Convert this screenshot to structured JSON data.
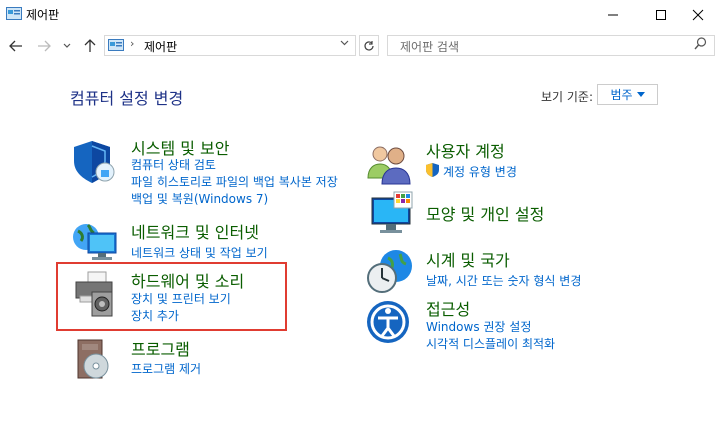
{
  "window": {
    "title": "제어판",
    "minimize_icon": "minimize-icon",
    "maximize_icon": "maximize-icon",
    "close_icon": "close-icon"
  },
  "nav": {
    "address_segment": "제어판",
    "search_placeholder": "제어판 검색"
  },
  "heading": {
    "title": "컴퓨터 설정 변경",
    "view_by_label": "보기 기준:",
    "view_by_value": "범주"
  },
  "categories": {
    "system": {
      "title": "시스템 및 보안",
      "links": [
        "컴퓨터 상태 검토",
        "파일 히스토리로 파일의 백업 복사본 저장",
        "백업 및 복원(Windows 7)"
      ]
    },
    "network": {
      "title": "네트워크 및 인터넷",
      "links": [
        "네트워크 상태 및 작업 보기"
      ]
    },
    "hardware": {
      "title": "하드웨어 및 소리",
      "links": [
        "장치 및 프린터 보기",
        "장치 추가"
      ]
    },
    "programs": {
      "title": "프로그램",
      "links": [
        "프로그램 제거"
      ]
    },
    "users": {
      "title": "사용자 계정",
      "links": [
        "계정 유형 변경"
      ]
    },
    "appearance": {
      "title": "모양 및 개인 설정",
      "links": []
    },
    "clock": {
      "title": "시계 및 국가",
      "links": [
        "날짜, 시간 또는 숫자 형식 변경"
      ]
    },
    "ease": {
      "title": "접근성",
      "links": [
        "Windows 권장 설정",
        "시각적 디스플레이 최적화"
      ]
    }
  },
  "colors": {
    "category_title": "#0a5d00",
    "link": "#0066cc",
    "heading": "#1e3287",
    "highlight": "#e03c31"
  }
}
